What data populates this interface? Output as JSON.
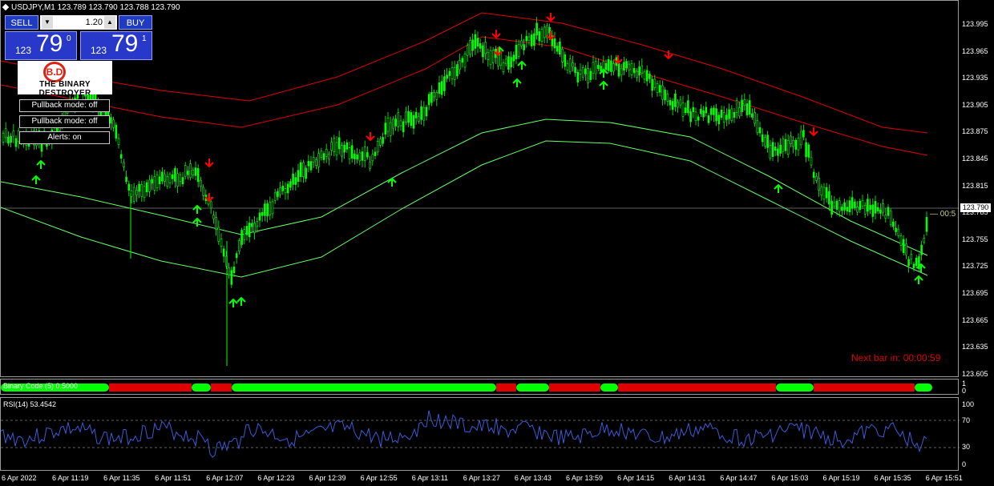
{
  "header": {
    "symbol": "USDJPY,M1",
    "ohlc": "123.789 123.790 123.788 123.790"
  },
  "trade_panel": {
    "sell_label": "SELL",
    "buy_label": "BUY",
    "lot": "1.20",
    "sell_price_small": "123",
    "sell_price_big": "79",
    "sell_price_sup": "0",
    "buy_price_small": "123",
    "buy_price_big": "79",
    "buy_price_sup": "1"
  },
  "logo": {
    "badge": "B.D",
    "text": "THE BINARY DESTROYER"
  },
  "controls": [
    {
      "label": "Pullback mode: off"
    },
    {
      "label": "Pullback mode: off"
    },
    {
      "label": "Alerts: on"
    }
  ],
  "next_bar": "Next bar in: 00:00:59",
  "current_price": "123.790",
  "current_price_extra": "— 00:5",
  "price_axis": [
    "123.995",
    "123.965",
    "123.935",
    "123.905",
    "123.875",
    "123.845",
    "123.815",
    "123.785",
    "123.755",
    "123.725",
    "123.695",
    "123.665",
    "123.635",
    "123.605"
  ],
  "binary_indicator": {
    "label": "Binary Code (5) 0.5000",
    "axis": [
      "1",
      "0"
    ],
    "colors": {
      "up": "#00ff00",
      "down": "#e00000"
    },
    "segments": [
      {
        "start": 0,
        "end": 135,
        "state": "up"
      },
      {
        "start": 135,
        "end": 238,
        "state": "down"
      },
      {
        "start": 238,
        "end": 262,
        "state": "up"
      },
      {
        "start": 262,
        "end": 288,
        "state": "down"
      },
      {
        "start": 288,
        "end": 618,
        "state": "up"
      },
      {
        "start": 618,
        "end": 643,
        "state": "down"
      },
      {
        "start": 643,
        "end": 684,
        "state": "up"
      },
      {
        "start": 684,
        "end": 748,
        "state": "down"
      },
      {
        "start": 748,
        "end": 770,
        "state": "up"
      },
      {
        "start": 770,
        "end": 967,
        "state": "down"
      },
      {
        "start": 967,
        "end": 1014,
        "state": "up"
      },
      {
        "start": 1014,
        "end": 1140,
        "state": "down"
      },
      {
        "start": 1140,
        "end": 1162,
        "state": "up"
      }
    ]
  },
  "rsi": {
    "label": "RSI(14) 53.4542",
    "axis": [
      "100",
      "70",
      "30",
      "0"
    ]
  },
  "time_axis": [
    "6 Apr 2022",
    "6 Apr 11:19",
    "6 Apr 11:35",
    "6 Apr 11:51",
    "6 Apr 12:07",
    "6 Apr 12:23",
    "6 Apr 12:39",
    "6 Apr 12:55",
    "6 Apr 13:11",
    "6 Apr 13:27",
    "6 Apr 13:43",
    "6 Apr 13:59",
    "6 Apr 14:15",
    "6 Apr 14:31",
    "6 Apr 14:47",
    "6 Apr 15:03",
    "6 Apr 15:19",
    "6 Apr 15:35",
    "6 Apr 15:51"
  ],
  "colors": {
    "bull_candle": "#00ff00",
    "band_upper": "#e00000",
    "band_lower": "#66ff66",
    "rsi_line": "#3a5bd9",
    "arrow_up": "#00ff00",
    "arrow_down": "#ff0000"
  }
}
